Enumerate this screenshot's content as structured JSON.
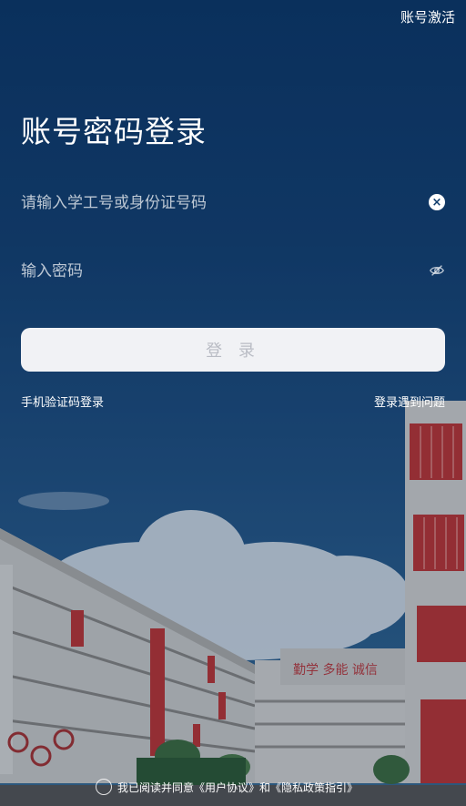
{
  "header": {
    "activate_label": "账号激活"
  },
  "page": {
    "title": "账号密码登录"
  },
  "form": {
    "username_placeholder": "请输入学工号或身份证号码",
    "password_placeholder": "输入密码",
    "login_label": "登 录"
  },
  "links": {
    "sms_login": "手机验证码登录",
    "login_problem": "登录遇到问题"
  },
  "building": {
    "slogan": "勤学  多能  诚信"
  },
  "agreement": {
    "text_prefix": "我已阅读并同意",
    "user_agreement": "《用户协议》",
    "and": "和",
    "privacy_policy": "《隐私政策指引》"
  },
  "icons": {
    "clear": "clear-icon",
    "eye": "eye-slash-icon"
  },
  "colors": {
    "background_top": "#0b3566",
    "button_bg": "#f1f2f5",
    "button_text": "#b9bcc4",
    "accent_red": "#c83a3a"
  }
}
